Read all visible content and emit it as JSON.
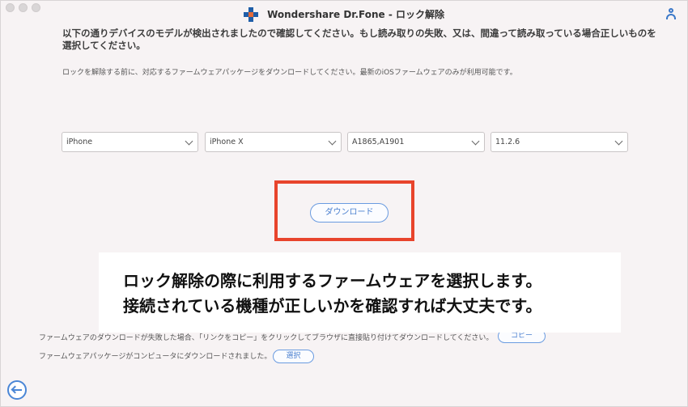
{
  "window": {
    "title": "Wondershare Dr.Fone - ロック解除",
    "user_icon": "user-icon",
    "logo_colors": {
      "primary": "#1f5ea8",
      "accent": "#e36b39"
    }
  },
  "instructions": {
    "main": "以下の通りデバイスのモデルが検出されましたので確認してください。もし読み取りの失敗、又は、間違って読み取っている場合正しいものを選択してください。",
    "note": "ロックを解除する前に、対応するファームウェアパッケージをダウンロードしてください。最新のiOSファームウェアのみが利用可能です。"
  },
  "selects": [
    {
      "value": "iPhone"
    },
    {
      "value": "iPhone X"
    },
    {
      "value": "A1865,A1901"
    },
    {
      "value": "11.2.6"
    }
  ],
  "download": {
    "label": "ダウンロード",
    "highlight_color": "#e8442c"
  },
  "overlay": {
    "line1": "ロック解除の際に利用するファームウェアを選択します。",
    "line2": "接続されている機種が正しいかを確認すれば大丈夫です。"
  },
  "footer": {
    "copy_text": "ファームウェアのダウンロードが失敗した場合、「リンクをコピー」をクリックしてブラウザに直接貼り付けてダウンロードしてください。",
    "copy_button": "コピー",
    "select_text": "ファームウェアパッケージがコンピュータにダウンロードされました。",
    "select_button": "選択"
  },
  "nav": {
    "back_icon": "back-arrow-icon"
  }
}
